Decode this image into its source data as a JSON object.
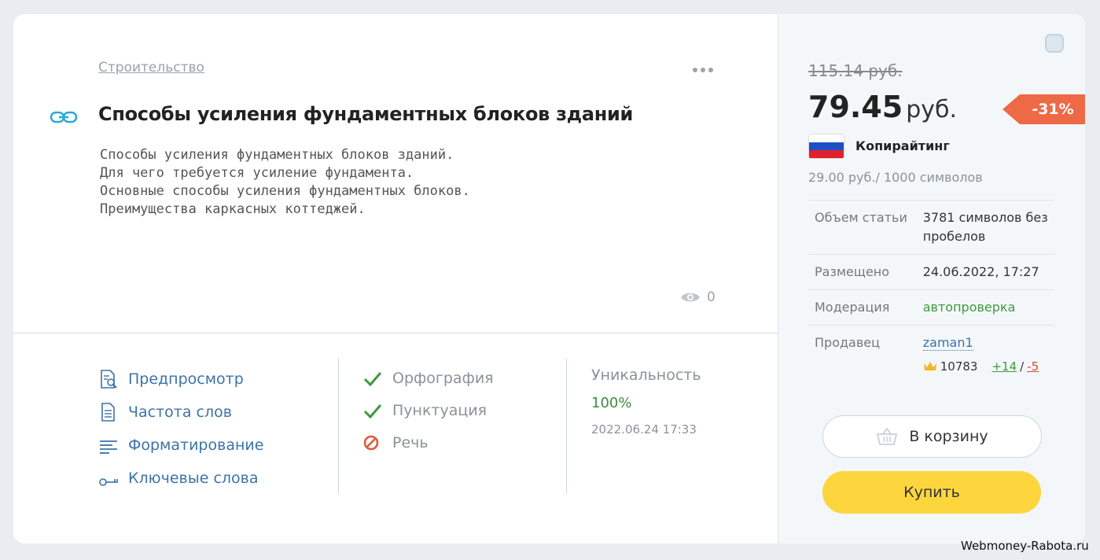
{
  "item": {
    "category": "Строительство",
    "title": "Способы усиления фундаментных блоков зданий",
    "description": [
      "Способы усиления фундаментных блоков зданий.",
      "Для чего требуется усиление фундамента.",
      "Основные способы усиления фундаментных блоков.",
      "Преимущества каркасных коттеджей."
    ],
    "views": "0"
  },
  "tools": [
    {
      "label": "Предпросмотр",
      "icon": "preview-icon"
    },
    {
      "label": "Частота слов",
      "icon": "document-icon"
    },
    {
      "label": "Форматирование",
      "icon": "format-lines-icon"
    },
    {
      "label": "Ключевые слова",
      "icon": "key-icon"
    }
  ],
  "checks": [
    {
      "label": "Орфография",
      "status": "ok"
    },
    {
      "label": "Пунктуация",
      "status": "ok"
    },
    {
      "label": "Речь",
      "status": "fail"
    }
  ],
  "uniqueness": {
    "label": "Уникальность",
    "value": "100%",
    "date": "2022.06.24 17:33"
  },
  "side": {
    "old_price": "115.14 руб.",
    "price": "79.45",
    "currency": "руб.",
    "discount": "-31%",
    "type": "Копирайтинг",
    "rate": "29.00 руб./ 1000 символов",
    "info": [
      {
        "k": "Объем статьи",
        "v": "3781 символов без пробелов"
      },
      {
        "k": "Размещено",
        "v": "24.06.2022, 17:27"
      },
      {
        "k": "Модерация",
        "v": "автопроверка"
      },
      {
        "k": "Продавец",
        "v": "zaman1"
      }
    ],
    "seller_rating": "10783",
    "seller_pos": "+14",
    "seller_sep": "/",
    "seller_neg": "-5",
    "cart_label": "В корзину",
    "buy_label": "Купить"
  },
  "colors": {
    "accent": "#3d72a8",
    "discount": "#ee6a47",
    "buy": "#fdd63e",
    "ok": "#3d9a3d",
    "fail": "#e05a3a"
  },
  "watermark": "Webmoney-Rabota.ru"
}
